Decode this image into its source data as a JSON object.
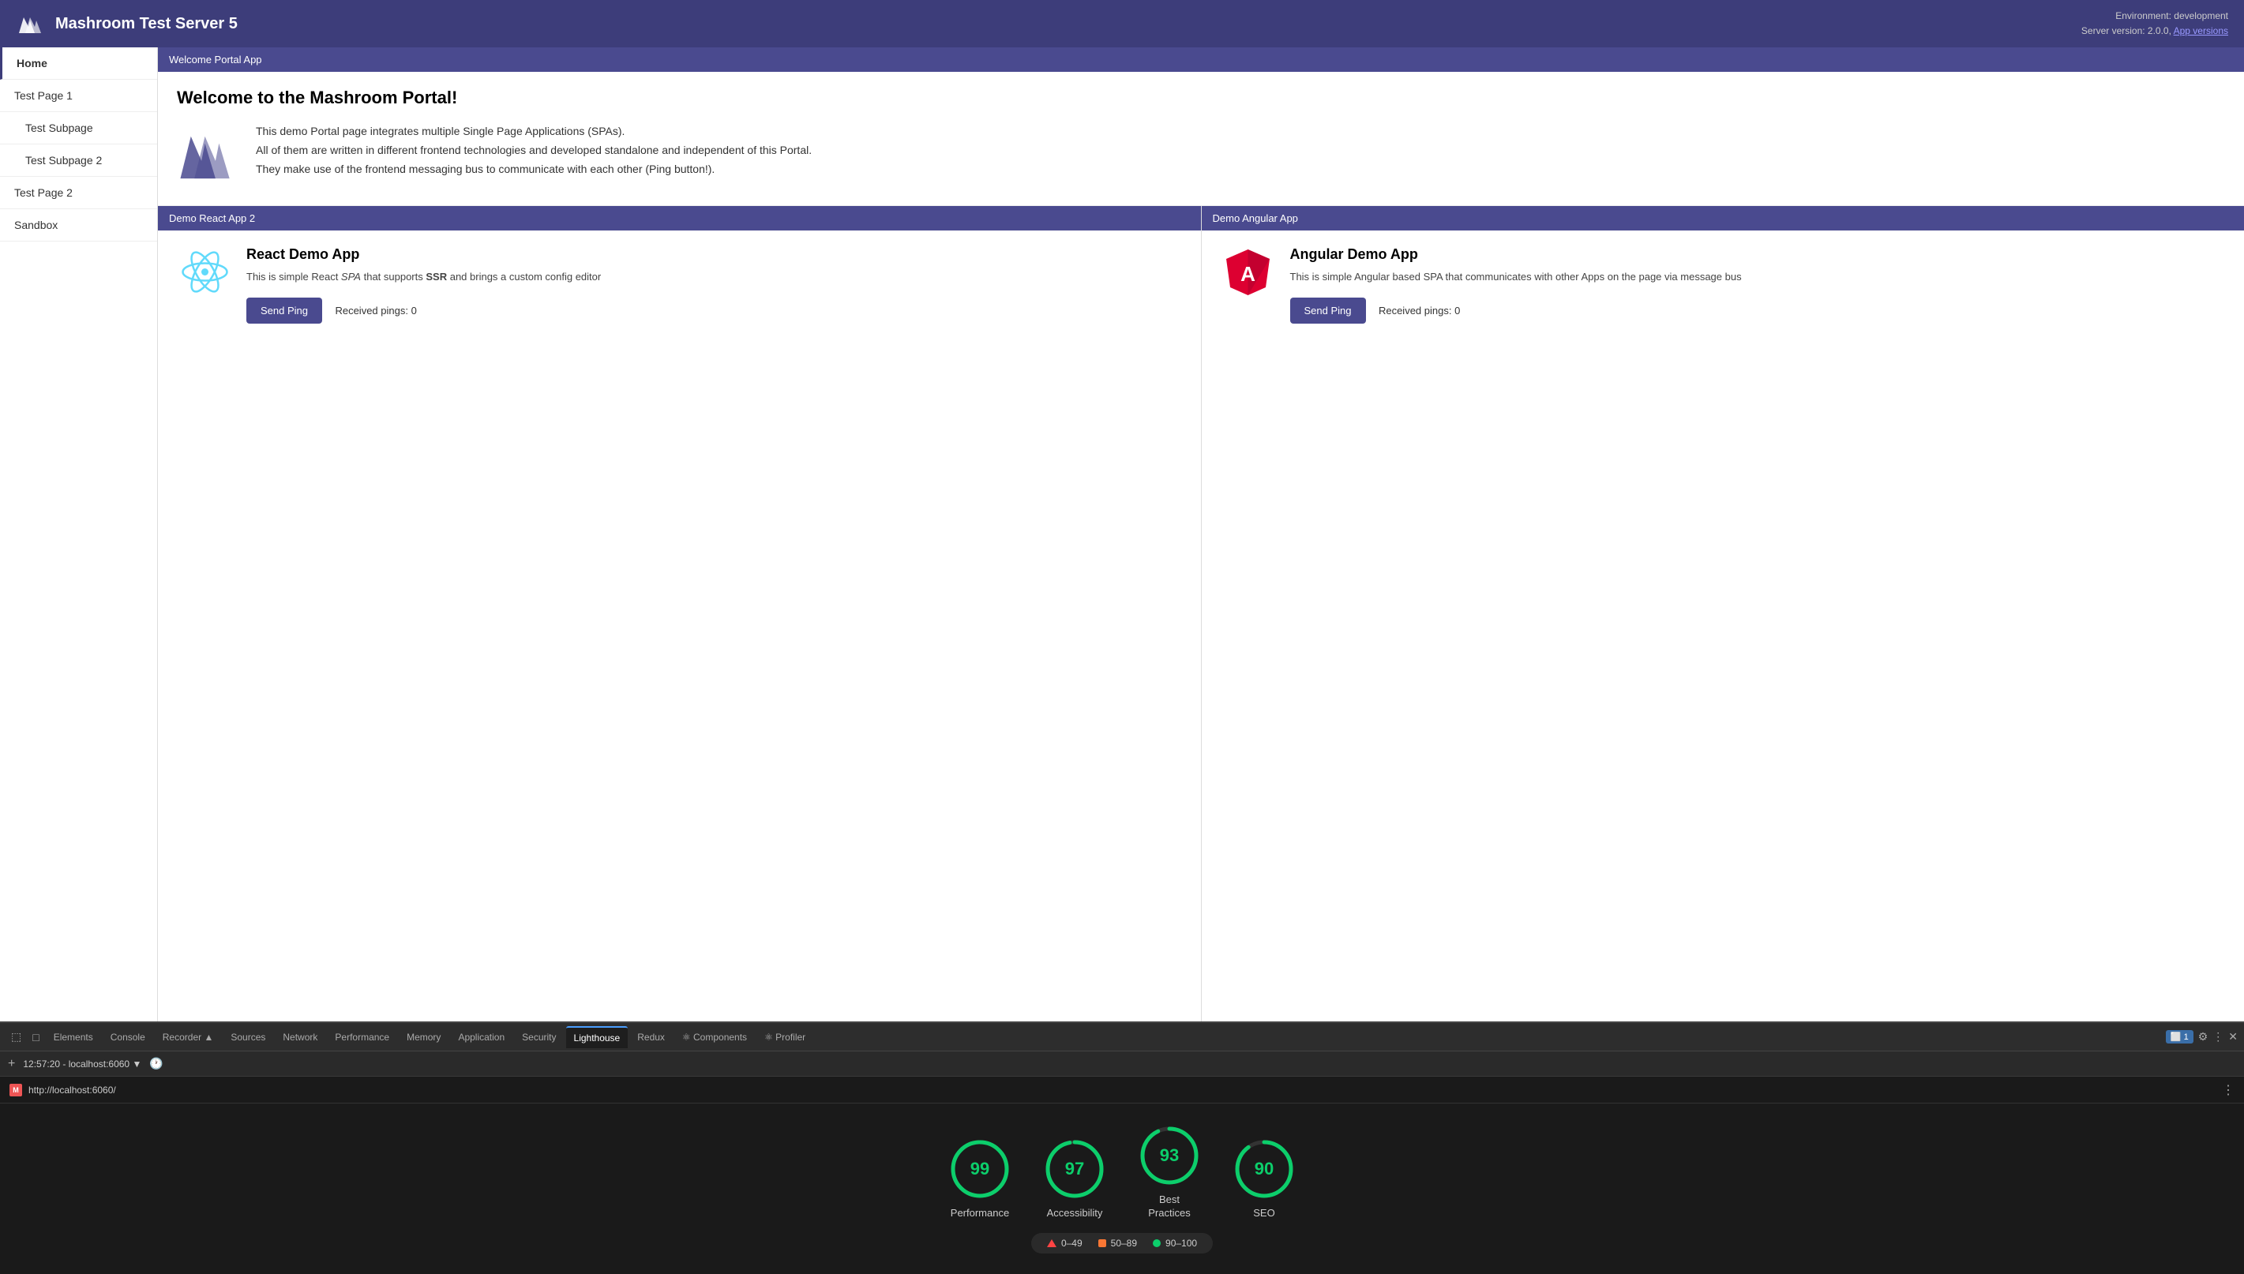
{
  "header": {
    "title": "Mashroom Test Server 5",
    "env_label": "Environment: development",
    "server_version": "Server version: 2.0.0,",
    "app_versions_link": "App versions"
  },
  "sidebar": {
    "items": [
      {
        "label": "Home",
        "active": true,
        "indent": false
      },
      {
        "label": "Test Page 1",
        "active": false,
        "indent": false
      },
      {
        "label": "Test Subpage",
        "active": false,
        "indent": true
      },
      {
        "label": "Test Subpage 2",
        "active": false,
        "indent": true
      },
      {
        "label": "Test Page 2",
        "active": false,
        "indent": false
      },
      {
        "label": "Sandbox",
        "active": false,
        "indent": false
      }
    ]
  },
  "welcome": {
    "section_header": "Welcome Portal App",
    "title": "Welcome to the Mashroom Portal!",
    "description_line1": "This demo Portal page integrates multiple Single Page Applications (SPAs).",
    "description_line2": "All of them are written in different frontend technologies and developed standalone and independent of this Portal.",
    "description_line3": "They make use of the frontend messaging bus to communicate with each other (Ping button!)."
  },
  "react_app": {
    "card_header": "Demo React App 2",
    "app_name": "React Demo App",
    "description": "This is simple React SPA that supports SSR and brings a custom config editor",
    "description_italic": "SPA",
    "description_bold": "SSR",
    "send_ping_label": "Send Ping",
    "received_pings_label": "Received pings: 0"
  },
  "angular_app": {
    "card_header": "Demo Angular App",
    "app_name": "Angular Demo App",
    "description": "This is simple Angular based SPA that communicates with other Apps on the page via message bus",
    "send_ping_label": "Send Ping",
    "received_pings_label": "Received pings: 0"
  },
  "devtools": {
    "tabs": [
      {
        "label": "Elements",
        "active": false
      },
      {
        "label": "Console",
        "active": false
      },
      {
        "label": "Recorder ▲",
        "active": false
      },
      {
        "label": "Sources",
        "active": false
      },
      {
        "label": "Network",
        "active": false
      },
      {
        "label": "Performance",
        "active": false
      },
      {
        "label": "Memory",
        "active": false
      },
      {
        "label": "Application",
        "active": false
      },
      {
        "label": "Security",
        "active": false
      },
      {
        "label": "Lighthouse",
        "active": true
      },
      {
        "label": "Redux",
        "active": false
      },
      {
        "label": "⚛ Components",
        "active": false
      },
      {
        "label": "⚛ Profiler",
        "active": false
      }
    ],
    "toolbar_time": "12:57:20 - localhost:6060 ▼",
    "url": "http://localhost:6060/",
    "scores": [
      {
        "label": "Performance",
        "value": 99
      },
      {
        "label": "Accessibility",
        "value": 97
      },
      {
        "label": "Best Practices",
        "value": 93
      },
      {
        "label": "SEO",
        "value": 90
      }
    ],
    "legend": [
      {
        "type": "triangle",
        "range": "0–49"
      },
      {
        "type": "square",
        "range": "50–89"
      },
      {
        "type": "dot",
        "range": "90–100"
      }
    ]
  }
}
